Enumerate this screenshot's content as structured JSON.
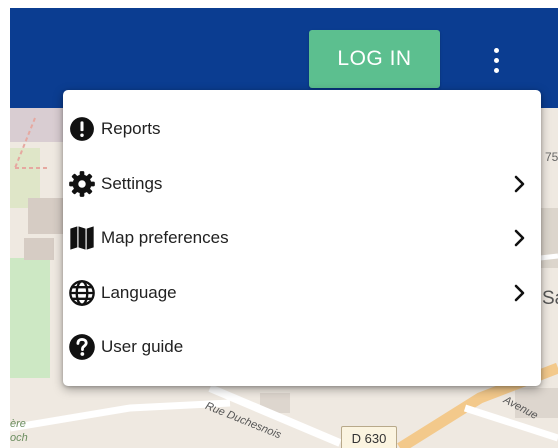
{
  "header": {
    "background_color": "#0b3d91",
    "login_label": "LOG IN",
    "login_color": "#5cbf8f",
    "more_icon": "more-vert-icon"
  },
  "menu": {
    "items": [
      {
        "label": "Reports",
        "icon": "alert-circle-icon",
        "has_submenu": false
      },
      {
        "label": "Settings",
        "icon": "gear-icon",
        "has_submenu": true
      },
      {
        "label": "Map preferences",
        "icon": "map-icon",
        "has_submenu": true
      },
      {
        "label": "Language",
        "icon": "globe-icon",
        "has_submenu": true
      },
      {
        "label": "User guide",
        "icon": "help-circle-icon",
        "has_submenu": false
      }
    ]
  },
  "map": {
    "road_label": "D 630",
    "street_label_1": "Rue Duchesnois",
    "street_label_2": "Avenue",
    "place_fragment_1": "ère",
    "place_fragment_2": "och",
    "place_fragment_3": "Sa",
    "place_fragment_4": "75"
  }
}
